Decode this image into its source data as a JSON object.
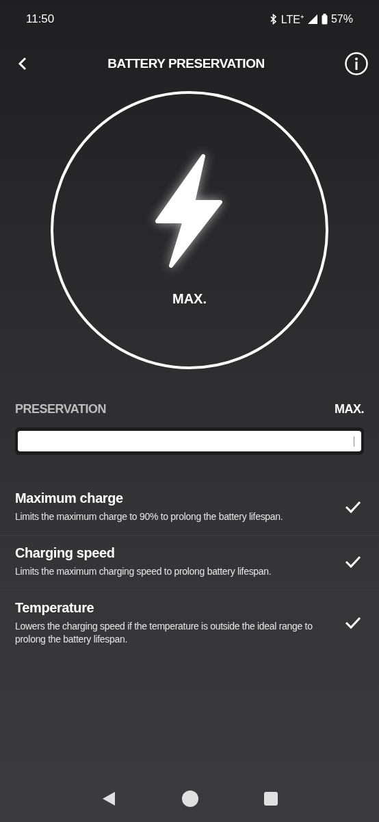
{
  "status_bar": {
    "time": "11:50",
    "network": "LTE⁺",
    "battery": "57%"
  },
  "header": {
    "title": "BATTERY PRESERVATION"
  },
  "dial": {
    "label": "MAX."
  },
  "preservation": {
    "label": "PRESERVATION",
    "value": "MAX.",
    "level": 1.0
  },
  "options": [
    {
      "title": "Maximum charge",
      "description": "Limits the maximum charge to 90% to prolong the battery lifespan.",
      "checked": true
    },
    {
      "title": "Charging speed",
      "description": "Limits the maximum charging speed to prolong battery lifespan.",
      "checked": true
    },
    {
      "title": "Temperature",
      "description": "Lowers the charging speed if the temperature is outside the ideal range to prolong the battery lifespan.",
      "checked": true
    }
  ]
}
